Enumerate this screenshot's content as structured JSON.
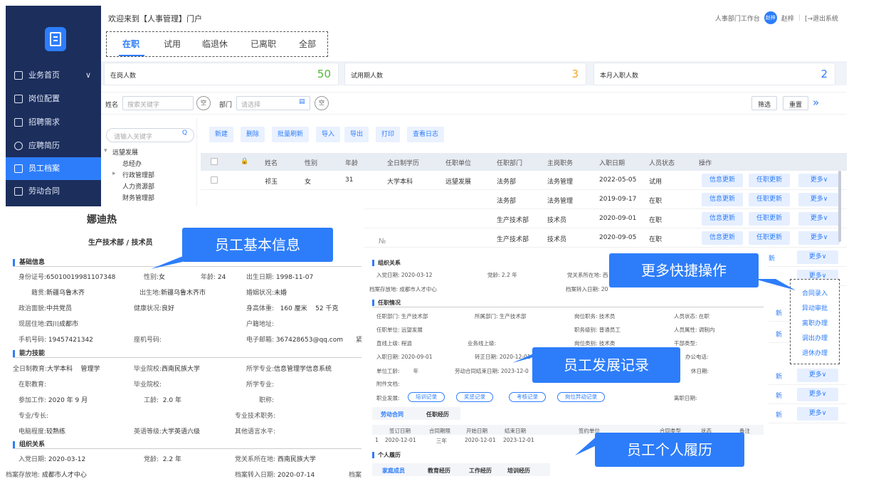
{
  "sidebar": {
    "items": [
      {
        "label": "业务首页",
        "icon": "layers-icon"
      },
      {
        "label": "岗位配置",
        "icon": "grid-icon"
      },
      {
        "label": "招聘需求",
        "icon": "document-icon"
      },
      {
        "label": "应聘简历",
        "icon": "users-icon"
      },
      {
        "label": "员工档案",
        "icon": "folder-icon"
      },
      {
        "label": "劳动合同",
        "icon": "contract-icon"
      }
    ]
  },
  "header": {
    "welcome": "欢迎来到【人事管理】门户",
    "workbench": "人事部门工作台",
    "avatar_text": "赵梓",
    "user": "赵梓",
    "logout": "[→退出系统"
  },
  "tabs": [
    "在职",
    "试用",
    "临退休",
    "已离职",
    "全部"
  ],
  "stats": [
    {
      "label": "在岗人数",
      "value": "50",
      "color": "#52b63a"
    },
    {
      "label": "试用期人数",
      "value": "3",
      "color": "#f5a623"
    },
    {
      "label": "本月入职人数",
      "value": "2",
      "color": "#2d7dfa"
    }
  ],
  "filter": {
    "name_label": "姓名",
    "name_placeholder": "搜索关键字",
    "empty": "空",
    "dept_label": "部门",
    "dept_placeholder": "请选择",
    "filter_btn": "筛选",
    "reset_btn": "重置",
    "expand": "»"
  },
  "tree": {
    "search_placeholder": "请输入关键字",
    "items": [
      "远望发展",
      "总经办",
      "行政管理部",
      "人力资源部",
      "财务管理部"
    ]
  },
  "toolbar": [
    "新建",
    "删除",
    "批量刷新",
    "导入",
    "导出",
    "打印",
    "查看日志"
  ],
  "table": {
    "headers": [
      "姓名",
      "性别",
      "年龄",
      "全日制学历",
      "任职单位",
      "任职部门",
      "主岗职务",
      "入职日期",
      "人员状态",
      "操作"
    ],
    "rows": [
      {
        "name": "祁玉",
        "gender": "女",
        "age": "31",
        "edu": "大学本科",
        "unit": "远望发展",
        "dept": "法务部",
        "job": "法务管理",
        "date": "2022-05-05",
        "status": "试用"
      },
      {
        "dept": "法务部",
        "job": "法务管理",
        "date": "2019-09-17",
        "status": "在职"
      },
      {
        "dept": "生产技术部",
        "job": "技术员",
        "date": "2020-09-01",
        "status": "在职"
      },
      {
        "dept": "生产技术部",
        "job": "技术员",
        "date": "2020-09-05",
        "status": "在职"
      }
    ],
    "actions": {
      "info": "信息更新",
      "post": "任职更新",
      "more": "更多∨",
      "partial": "新"
    }
  },
  "dropdown": [
    "合同录入",
    "异动审批",
    "离职办理",
    "调出办理",
    "退休办理"
  ],
  "callouts": {
    "basic": "员工基本信息",
    "more": "更多快捷操作",
    "dev": "员工发展记录",
    "resume": "员工个人履历"
  },
  "profile": {
    "name": "娜迪热",
    "dept_title": "生产技术部 / 技术员",
    "sec_basic": "基础信息",
    "id_label": "身份证号:",
    "id": "65010019981107348",
    "gender_label": "性别:",
    "gender": "女",
    "age_label": "年龄:",
    "age": "24",
    "birth_label": "出生日期:",
    "birth": "1998-11-07",
    "origin_label": "籍贯:",
    "origin": "新疆乌鲁木齐",
    "birthplace_label": "出生地:",
    "birthplace": "新疆乌鲁木齐市",
    "marital_label": "婚姻状况:",
    "marital": "未婚",
    "politics_label": "政治面貌:",
    "politics": "中共党员",
    "health_label": "健康状况:",
    "health": "良好",
    "height_label": "身高体重:",
    "height": "160 厘米",
    "weight": "52 千克",
    "residence_label": "现居住地:",
    "residence": "四川成都市",
    "hukou_label": "户籍地址:",
    "phone_label": "手机号码:",
    "phone": "19457421342",
    "landline_label": "座机号码:",
    "email_label": "电子邮箱:",
    "email": "367428653@qq.com",
    "email_cut": "紧",
    "sec_skill": "能力技能",
    "edu_label": "全日制教育:",
    "edu": "大学本科",
    "major_short": "管理学",
    "school_label": "毕业院校:",
    "school": "西南民族大学",
    "major_label": "所学专业:",
    "major": "信息管理学信息系统",
    "onjob_label": "在职教育:",
    "school2_label": "毕业院校:",
    "major2_label": "所学专业:",
    "work_label": "参加工作:",
    "work": "2020 年 9 月",
    "worklen_label": "工龄:",
    "worklen": "2.0 年",
    "title_label": "职称:",
    "specialty_label": "专业/专长:",
    "techpost_label": "专业技术职务:",
    "computer_label": "电脑程度:",
    "computer": "较熟练",
    "english_label": "英语等级:",
    "english": "大学英语六级",
    "otherlang_label": "其他语言水平:",
    "sec_org": "组织关系",
    "party_label": "入党日期:",
    "party": "2020-03-12",
    "partyage_label": "党龄:",
    "partyage": "2.2 年",
    "partyorg_label": "党关系所在地:",
    "partyorg": "西南民族大学",
    "archive_label": "档案存放地:",
    "archive": "成都市人才中心",
    "archive_date_label": "档案转入日期:",
    "archive_date": "2020-07-14",
    "archive_cut": "档案"
  },
  "detail": {
    "no": "№",
    "sec_org": "组织关系",
    "party": "入党日期: 2020-03-12",
    "partyage": "党龄:  2.2  年",
    "partyorg": "党关系所在地: 西",
    "archive": "档案存放地: 成都市人才中心",
    "archive_date": "档案转入日期: 20",
    "sec_post": "任职情况",
    "post_dept": "任职部门: 生产技术部",
    "belong_dept": "所属部门: 生产技术部",
    "post_job": "岗位职务: 技术员",
    "staff_status": "人员状态: 在职",
    "post_unit": "任职单位: 远望发展",
    "job_level": "职务级别: 普通员工",
    "staff_attr": "人员属性: 调制内",
    "direct_lead": "直线上级: 程逍",
    "biz_lead": "业务线上级:",
    "post_type": "岗位类别: 技术类",
    "cadre": "干部类型:",
    "entry": "入职日期: 2020-09-01",
    "regular": "转正日期: 2020-12-01",
    "office_phone": "办公电话:",
    "seniority": "单位工龄:",
    "seniority_unit": "年",
    "contract_end": "劳动合同结束日期: 2023-12-0",
    "retire": "休日期:",
    "attach": "附件文档:",
    "career": "职业发展:",
    "pills": [
      "培训记录",
      "奖惩记录",
      "考核记录",
      "岗位异动记录"
    ],
    "leave": "离职日期:",
    "tab_contract": "劳动合同",
    "tab_post": "任职经历",
    "contract_headers": [
      "签订日期",
      "合同期限",
      "开始日期",
      "结束日期",
      "签约单位",
      "合同类型",
      "状态",
      "备注"
    ],
    "contract_row": [
      "1",
      "2020-12-01",
      "三年",
      "2020-12-01",
      "2023-12-01"
    ],
    "sec_resume": "个人履历",
    "resume_tabs": [
      "家庭成员",
      "教育经历",
      "工作经历",
      "培训经历"
    ]
  }
}
